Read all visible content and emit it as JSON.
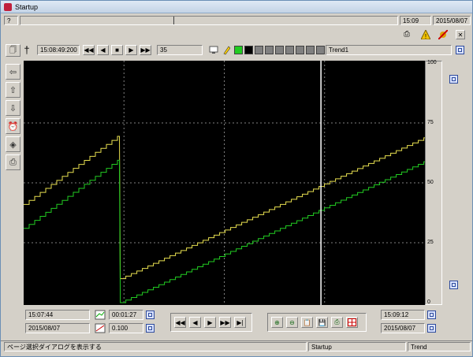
{
  "window": {
    "title": "Startup"
  },
  "topbar": {
    "help": "?",
    "time": "15:09",
    "date": "2015/08/07"
  },
  "toolbar": {
    "cursor_time": "15:08:49:200",
    "value_field": "35",
    "trend_name": "Trend1",
    "color_swatches": [
      "#22cc22",
      "#000000",
      "#808080",
      "#808080",
      "#808080",
      "#808080",
      "#808080",
      "#808080",
      "#808080"
    ]
  },
  "yaxis": {
    "ticks": [
      "100",
      "75",
      "50",
      "25",
      "0"
    ]
  },
  "bottom": {
    "start_time": "15:07:44",
    "start_date": "2015/08/07",
    "span": "00:01:27",
    "ratio": "0.100",
    "end_time": "15:09:12",
    "end_date": "2015/08/07"
  },
  "statusbar": {
    "message": "ページ選択ダイアログを表示する",
    "screen": "Startup",
    "mode": "Trend"
  },
  "colors": {
    "series_yellow": "#e8e050",
    "series_green": "#22cc22",
    "grid": "#808080",
    "cursor": "#ffffff"
  },
  "chart_data": {
    "type": "line",
    "ylim": [
      0,
      100
    ],
    "yticks": [
      0,
      25,
      50,
      75,
      100
    ],
    "xlim": [
      "15:07:44",
      "15:09:12"
    ],
    "cursor": "15:08:49:200",
    "series": [
      {
        "x": [
          "15:07:44",
          "15:08:05",
          "15:08:05.2",
          "15:09:12"
        ],
        "values": [
          41,
          70,
          10,
          69
        ]
      },
      {
        "x": [
          "15:07:44",
          "15:08:05",
          "15:08:05.2",
          "15:09:12"
        ],
        "values": [
          31,
          60,
          0,
          59
        ]
      }
    ]
  }
}
